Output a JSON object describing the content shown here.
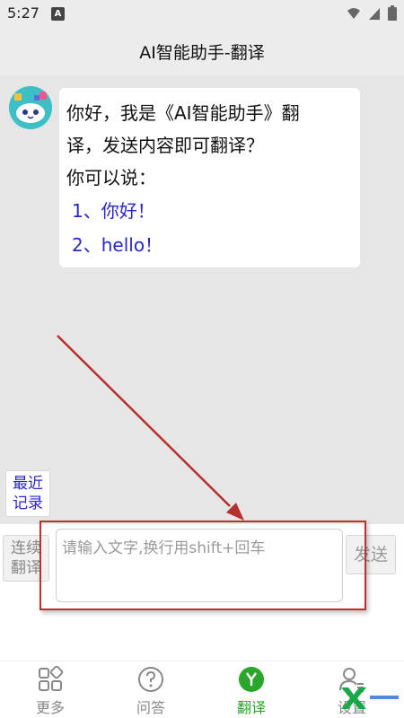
{
  "status_bar": {
    "time": "5:27",
    "app_badge": "A",
    "icons": [
      "wifi-icon",
      "cellular-icon",
      "battery-icon"
    ]
  },
  "header": {
    "title": "AI智能助手-翻译"
  },
  "chat": {
    "messages": [
      {
        "sender": "bot",
        "lines": [
          "你好，我是《AI智能助手》翻",
          "译，发送内容即可翻译？",
          "你可以说："
        ],
        "suggestions": [
          "1、你好！",
          "2、hello！"
        ]
      }
    ]
  },
  "recent_button": {
    "line1": "最近",
    "line2": "记录"
  },
  "composer": {
    "continuous_line1": "连续",
    "continuous_line2": "翻译",
    "placeholder": "请输入文字,换行用shift+回车",
    "value": "",
    "send_label": "发送"
  },
  "bottom_nav": {
    "items": [
      {
        "label": "更多",
        "icon": "grid-icon",
        "active": false
      },
      {
        "label": "问答",
        "icon": "question-icon",
        "active": false
      },
      {
        "label": "翻译",
        "icon": "translate-y-icon",
        "active": true
      },
      {
        "label": "设置",
        "icon": "user-settings-icon",
        "active": false
      }
    ]
  },
  "colors": {
    "accent_green": "#2aa62a",
    "link_blue": "#2a26c9",
    "annotation_red": "#c0312e"
  }
}
